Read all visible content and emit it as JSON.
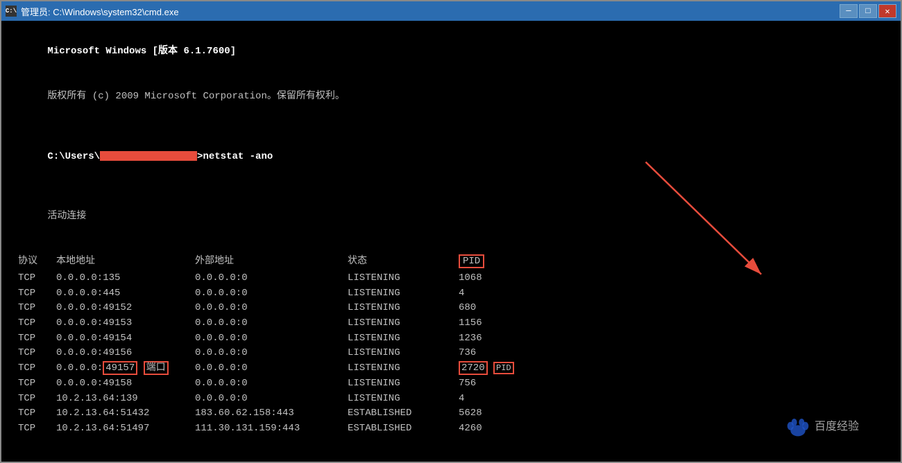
{
  "titleBar": {
    "icon": "C:\\",
    "title": "管理员: C:\\Windows\\system32\\cmd.exe",
    "minimizeLabel": "─",
    "maximizeLabel": "□",
    "closeLabel": "✕"
  },
  "console": {
    "line1": "Microsoft Windows [版本 6.1.7600]",
    "line2": "版权所有 (c) 2009 Microsoft Corporation。保留所有权利。",
    "line3": "",
    "promptPrefix": "C:\\Users\\",
    "promptRedacted": "████████████████",
    "promptSuffix": ">netstat -ano",
    "line4": "",
    "activeConnections": "活动连接",
    "line5": "",
    "headers": {
      "proto": "协议",
      "local": "本地地址",
      "remote": "外部地址",
      "state": "状态",
      "pid": "PID"
    },
    "rows": [
      {
        "proto": "TCP",
        "local": "0.0.0.0:135",
        "remote": "0.0.0.0:0",
        "state": "LISTENING",
        "pid": "1068"
      },
      {
        "proto": "TCP",
        "local": "0.0.0.0:445",
        "remote": "0.0.0.0:0",
        "state": "LISTENING",
        "pid": "4"
      },
      {
        "proto": "TCP",
        "local": "0.0.0.0:49152",
        "remote": "0.0.0.0:0",
        "state": "LISTENING",
        "pid": "680"
      },
      {
        "proto": "TCP",
        "local": "0.0.0.0:49153",
        "remote": "0.0.0.0:0",
        "state": "LISTENING",
        "pid": "1156"
      },
      {
        "proto": "TCP",
        "local": "0.0.0.0:49154",
        "remote": "0.0.0.0:0",
        "state": "LISTENING",
        "pid": "1236"
      },
      {
        "proto": "TCP",
        "local": "0.0.0.0:49156",
        "remote": "0.0.0.0:0",
        "state": "LISTENING",
        "pid": "736"
      },
      {
        "proto": "TCP",
        "local": "0.0.0.0:49157",
        "remote": "0.0.0.0:0",
        "state": "LISTENING",
        "pid": "2720",
        "highlightPort": true,
        "highlightPid": true
      },
      {
        "proto": "TCP",
        "local": "0.0.0.0:49158",
        "remote": "0.0.0.0:0",
        "state": "LISTENING",
        "pid": "756"
      },
      {
        "proto": "TCP",
        "local": "10.2.13.64:139",
        "remote": "0.0.0.0:0",
        "state": "LISTENING",
        "pid": "4"
      },
      {
        "proto": "TCP",
        "local": "10.2.13.64:51432",
        "remote": "183.60.62.158:443",
        "state": "ESTABLISHED",
        "pid": "5628"
      },
      {
        "proto": "TCP",
        "local": "10.2.13.64:51497",
        "remote": "111.30.131.159:443",
        "state": "ESTABLISHED",
        "pid": "4260"
      }
    ],
    "portLabel": "端口",
    "pidAnnotationLabel": "PID",
    "pidHeaderAnnotation": "PID"
  }
}
